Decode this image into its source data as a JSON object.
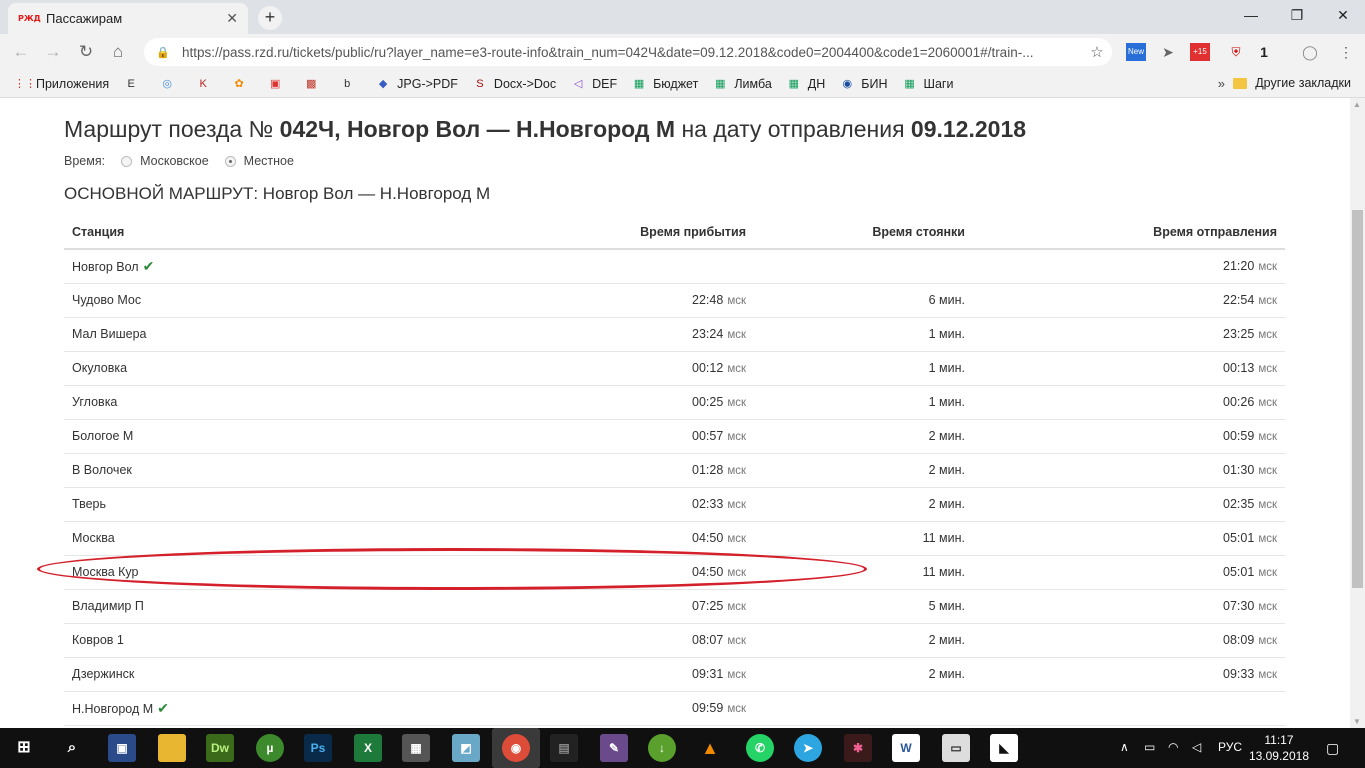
{
  "browser": {
    "tab_title": "Пассажирам",
    "tab_favicon_text": "РЖД",
    "url": "https://pass.rzd.ru/tickets/public/ru?layer_name=e3-route-info&train_num=042Ч&date=09.12.2018&code0=2004400&code1=2060001#/train-...",
    "bookmarks": [
      {
        "label": "Приложения",
        "icon": "apps-grid-icon",
        "color": "#d93025"
      },
      {
        "label": "",
        "icon": "e-icon",
        "color": "#333"
      },
      {
        "label": "",
        "icon": "o-icon",
        "color": "#4a8fd8"
      },
      {
        "label": "",
        "icon": "k-icon",
        "color": "#b22"
      },
      {
        "label": "",
        "icon": "film-icon",
        "color": "#f08a00"
      },
      {
        "label": "",
        "icon": "tv-icon",
        "color": "#d33"
      },
      {
        "label": "",
        "icon": "image-icon",
        "color": "#c0392b"
      },
      {
        "label": "",
        "icon": "b-icon",
        "color": "#333"
      },
      {
        "label": "JPG->PDF",
        "icon": "pdf-icon",
        "color": "#3b5bc4"
      },
      {
        "label": "Docx->Doc",
        "icon": "s-icon",
        "color": "#a01010"
      },
      {
        "label": "DEF",
        "icon": "vs-icon",
        "color": "#8a4fc4"
      },
      {
        "label": "Бюджет",
        "icon": "sheets-icon",
        "color": "#0f9d58"
      },
      {
        "label": "Лимба",
        "icon": "sheets-icon",
        "color": "#0f9d58"
      },
      {
        "label": "ДН",
        "icon": "sheets-icon",
        "color": "#0f9d58"
      },
      {
        "label": "БИН",
        "icon": "globe-icon",
        "color": "#1a4ea0"
      },
      {
        "label": "Шаги",
        "icon": "sheets-icon",
        "color": "#0f9d58"
      }
    ],
    "bookmarks_more": "»",
    "other_bookmarks": "Другие закладки"
  },
  "page": {
    "title_prefix": "Маршрут поезда № ",
    "train_number": "042Ч, Новгор Вол — Н.Новгород М",
    "title_middle": " на дату отправления ",
    "date": "09.12.2018",
    "time_label": "Время:",
    "time_option_1": "Московское",
    "time_option_2": "Местное",
    "route_header": "ОСНОВНОЙ МАРШРУТ: Новгор Вол — Н.Новгород М",
    "unit": "мск",
    "columns": [
      "Станция",
      "Время прибытия",
      "Время стоянки",
      "Время отправления"
    ],
    "rows": [
      {
        "station": "Новгор Вол",
        "arrival": "",
        "stop": "",
        "departure": "21:20",
        "check": true
      },
      {
        "station": "Чудово Мос",
        "arrival": "22:48",
        "stop": "6 мин.",
        "departure": "22:54"
      },
      {
        "station": "Мал Вишера",
        "arrival": "23:24",
        "stop": "1 мин.",
        "departure": "23:25"
      },
      {
        "station": "Окуловка",
        "arrival": "00:12",
        "stop": "1 мин.",
        "departure": "00:13"
      },
      {
        "station": "Угловка",
        "arrival": "00:25",
        "stop": "1 мин.",
        "departure": "00:26"
      },
      {
        "station": "Бологое М",
        "arrival": "00:57",
        "stop": "2 мин.",
        "departure": "00:59"
      },
      {
        "station": "В Волочек",
        "arrival": "01:28",
        "stop": "2 мин.",
        "departure": "01:30"
      },
      {
        "station": "Тверь",
        "arrival": "02:33",
        "stop": "2 мин.",
        "departure": "02:35"
      },
      {
        "station": "Москва",
        "arrival": "04:50",
        "stop": "11 мин.",
        "departure": "05:01"
      },
      {
        "station": "Москва Кур",
        "arrival": "04:50",
        "stop": "11 мин.",
        "departure": "05:01"
      },
      {
        "station": "Владимир П",
        "arrival": "07:25",
        "stop": "5 мин.",
        "departure": "07:30"
      },
      {
        "station": "Ковров 1",
        "arrival": "08:07",
        "stop": "2 мин.",
        "departure": "08:09"
      },
      {
        "station": "Дзержинск",
        "arrival": "09:31",
        "stop": "2 мин.",
        "departure": "09:33"
      },
      {
        "station": "Н.Новгород М",
        "arrival": "09:59",
        "stop": "",
        "departure": "",
        "check": true
      }
    ]
  },
  "taskbar": {
    "apps": [
      "Dw",
      "Ps"
    ],
    "lang": "РУС",
    "time": "11:17",
    "date": "13.09.2018"
  }
}
